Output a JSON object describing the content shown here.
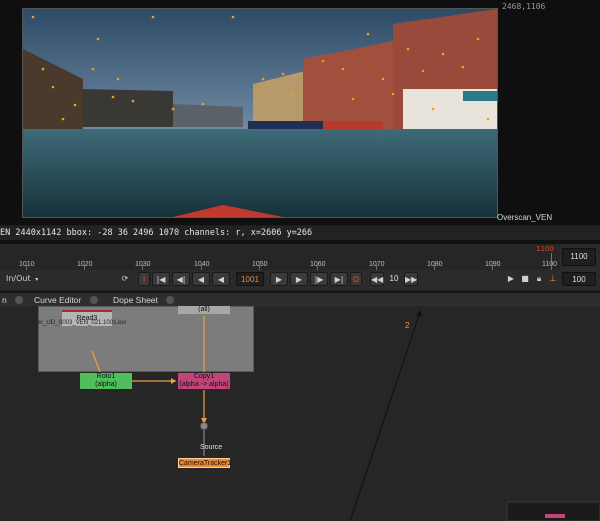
{
  "viewer": {
    "resolution_readout": "2468,1106",
    "overscan_label": "Overscan_VEN"
  },
  "infobar": {
    "text": "EN 2440x1142  bbox: -28 36 2496 1070 channels: r, x=2606 y=266"
  },
  "timeline": {
    "ticks": [
      "1010",
      "1020",
      "1030",
      "1040",
      "1050",
      "1060",
      "1070",
      "1080",
      "1090",
      "1100"
    ],
    "end_frame_marker": "1100",
    "end_frame_field": "1100",
    "inout_label": "In/Out",
    "current_frame": "1001",
    "step_value": "10",
    "fps_value": "100"
  },
  "tabs": [
    {
      "label": "n"
    },
    {
      "label": "Curve Editor"
    },
    {
      "label": "Dope Sheet"
    }
  ],
  "graph": {
    "read_node": {
      "title": "Read3",
      "file": "e_pc_UD_S003_VEN_021.1001.exr"
    },
    "top_node_label": "(all)",
    "roto_node": {
      "line1": "Roto1",
      "line2": "(alpha)"
    },
    "copy_node": {
      "line1": "Copy1",
      "line2": "(alpha -> alpha)"
    },
    "source_label": "Source",
    "tracker_node": "CameraTracker1",
    "marker_number": "2"
  },
  "colors": {
    "roto": "#4fbf5c",
    "copy": "#c2457a",
    "tracker": "#e98a3a",
    "arrow": "#e8a23a",
    "accent_red": "#e04b2a"
  }
}
